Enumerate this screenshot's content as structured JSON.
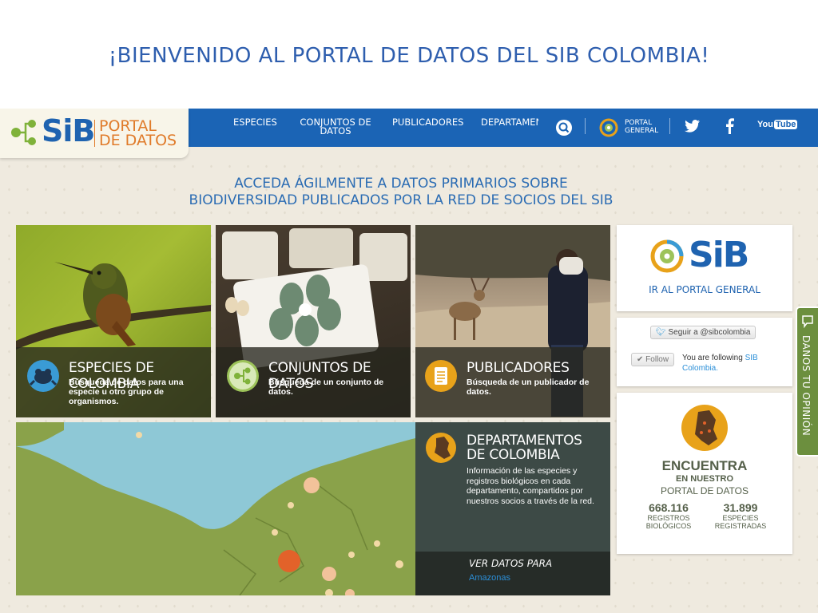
{
  "slide": {
    "title": "¡BIENVENIDO AL PORTAL DE DATOS DEL SIB COLOMBIA!"
  },
  "logo": {
    "sib": "SiB",
    "portal_line1": "PORTAL",
    "portal_line2": "DE DATOS"
  },
  "nav": {
    "items": [
      {
        "label": "ESPECIES"
      },
      {
        "label": "CONJUNTOS DE DATOS"
      },
      {
        "label": "PUBLICADORES"
      },
      {
        "label": "DEPARTAMEN"
      }
    ],
    "portal_general_line1": "PORTAL",
    "portal_general_line2": "GENERAL",
    "youtube_label": "You Tube"
  },
  "headline": {
    "line1": "ACCEDA ÁGILMENTE A DATOS PRIMARIOS SOBRE",
    "line2": "BIODIVERSIDAD PUBLICADOS POR LA RED DE SOCIOS DEL SIB"
  },
  "tiles": [
    {
      "title": "ESPECIES DE COLOMBIA",
      "desc": "Búsqueda de datos para una especie u otro grupo de organismos.",
      "icon_color": "#3a9bd5"
    },
    {
      "title": "CONJUNTOS DE DATOS",
      "desc": "Búsqueda de un conjunto de datos.",
      "icon_color": "#9dc35a"
    },
    {
      "title": "PUBLICADORES",
      "desc": "Búsqueda de un publicador de datos.",
      "icon_color": "#e8a21a"
    }
  ],
  "departamentos": {
    "title": "DEPARTAMENTOS DE COLOMBIA",
    "desc": "Información de las especies y registros biológicos en cada departamento, compartidos por nuestros socios a través de la red.",
    "ver_datos": "VER DATOS PARA",
    "selected": "Amazonas"
  },
  "sidebar": {
    "portal_sib": "SiB",
    "ir_portal": "IR AL PORTAL GENERAL",
    "twitter_follow": "Seguir a @sibcolombia",
    "follow_button": "Follow",
    "following_prefix": "You are following",
    "following_link": "SIB Colombia.",
    "encuentra": "ENCUENTRA",
    "en_nuestro": "EN NUESTRO",
    "portal_datos": "PORTAL DE DATOS",
    "stats": [
      {
        "value": "668.116",
        "line1": "REGISTROS",
        "line2": "BIOLÓGICOS"
      },
      {
        "value": "31.899",
        "line1": "ESPECIES",
        "line2": "REGISTRADAS"
      }
    ]
  },
  "feedback": {
    "label": "DANOS TU OPINIÓN"
  },
  "colors": {
    "brand_blue": "#1b64b5",
    "brand_orange": "#e07b2a",
    "brand_green": "#6c8f3e"
  }
}
